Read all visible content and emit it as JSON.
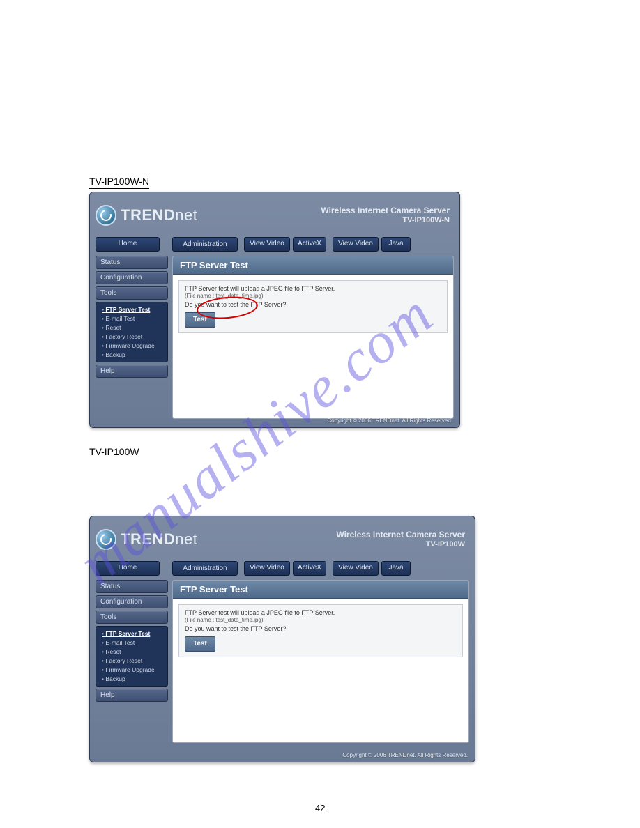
{
  "watermark": "manualshive.com",
  "captions": {
    "top_model": "TV-IP100W-N",
    "bottom_model": "TV-IP100W"
  },
  "pagenum": "42",
  "brand": {
    "trend": "TREND",
    "net": "net"
  },
  "header": {
    "title": "Wireless Internet Camera Server"
  },
  "nav": {
    "home": "Home",
    "admin": "Administration",
    "vv": "View Video",
    "ax": "ActiveX",
    "java": "Java"
  },
  "sidebar": {
    "status": "Status",
    "config": "Configuration",
    "tools": "Tools",
    "help": "Help",
    "items": [
      "FTP Server Test",
      "E-mail Test",
      "Reset",
      "Factory Reset",
      "Firmware Upgrade",
      "Backup"
    ]
  },
  "content": {
    "title": "FTP Server Test",
    "line1": "FTP Server test will upload a JPEG file to FTP Server.",
    "line2": "(File name : test_date_time.jpg)",
    "line3": "Do you want to test the FTP Server?",
    "button": "Test"
  },
  "copyright": "Copyright © 2006 TRENDnet. All Rights Reserved."
}
